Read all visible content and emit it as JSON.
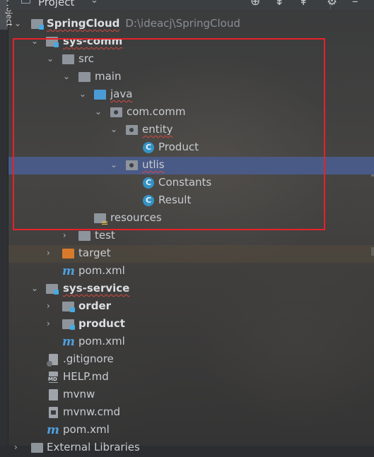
{
  "panel": {
    "title": "Project",
    "side_tab": "Project",
    "toolbar": [
      "locate-icon",
      "expand-all-icon",
      "collapse-all-icon",
      "gear-icon",
      "minimize-icon"
    ]
  },
  "tree": [
    {
      "label": "SpringCloud",
      "path": "D:\\ideacj\\SpringCloud",
      "icon": "module-folder-icon",
      "expanded": true,
      "bold": true
    },
    {
      "label": "sys-comm",
      "icon": "module-folder-icon",
      "expanded": true,
      "bold": true
    },
    {
      "label": "src",
      "icon": "folder-icon",
      "expanded": true
    },
    {
      "label": "main",
      "icon": "folder-icon",
      "expanded": true
    },
    {
      "label": "java",
      "icon": "source-folder-icon",
      "expanded": true
    },
    {
      "label": "com.comm",
      "icon": "package-icon",
      "expanded": true
    },
    {
      "label": "entity",
      "icon": "package-icon",
      "expanded": true
    },
    {
      "label": "Product",
      "icon": "class-icon"
    },
    {
      "label": "utlis",
      "icon": "package-icon",
      "expanded": true,
      "selected": true
    },
    {
      "label": "Constants",
      "icon": "class-icon"
    },
    {
      "label": "Result",
      "icon": "class-icon"
    },
    {
      "label": "resources",
      "icon": "resources-folder-icon"
    },
    {
      "label": "test",
      "icon": "folder-icon",
      "expanded": false
    },
    {
      "label": "target",
      "icon": "excluded-folder-icon",
      "expanded": false
    },
    {
      "label": "pom.xml",
      "icon": "maven-icon"
    },
    {
      "label": "sys-service",
      "icon": "module-folder-icon",
      "expanded": true,
      "bold": true
    },
    {
      "label": "order",
      "icon": "module-folder-icon",
      "expanded": false,
      "bold": true
    },
    {
      "label": "product",
      "icon": "module-folder-icon",
      "expanded": false,
      "bold": true
    },
    {
      "label": "pom.xml",
      "icon": "maven-icon"
    },
    {
      "label": ".gitignore",
      "icon": "gitignore-icon"
    },
    {
      "label": "HELP.md",
      "icon": "markdown-icon"
    },
    {
      "label": "mvnw",
      "icon": "file-icon"
    },
    {
      "label": "mvnw.cmd",
      "icon": "cmd-file-icon"
    },
    {
      "label": "pom.xml",
      "icon": "maven-icon"
    },
    {
      "label": "External Libraries",
      "icon": "library-icon",
      "expanded": false
    }
  ],
  "colors": {
    "selection": "#4a5a86",
    "highlight_box": "#e8202a",
    "class_icon": "#3592c4",
    "source_folder": "#4a9cd6",
    "excluded_folder": "#d97a2b"
  }
}
